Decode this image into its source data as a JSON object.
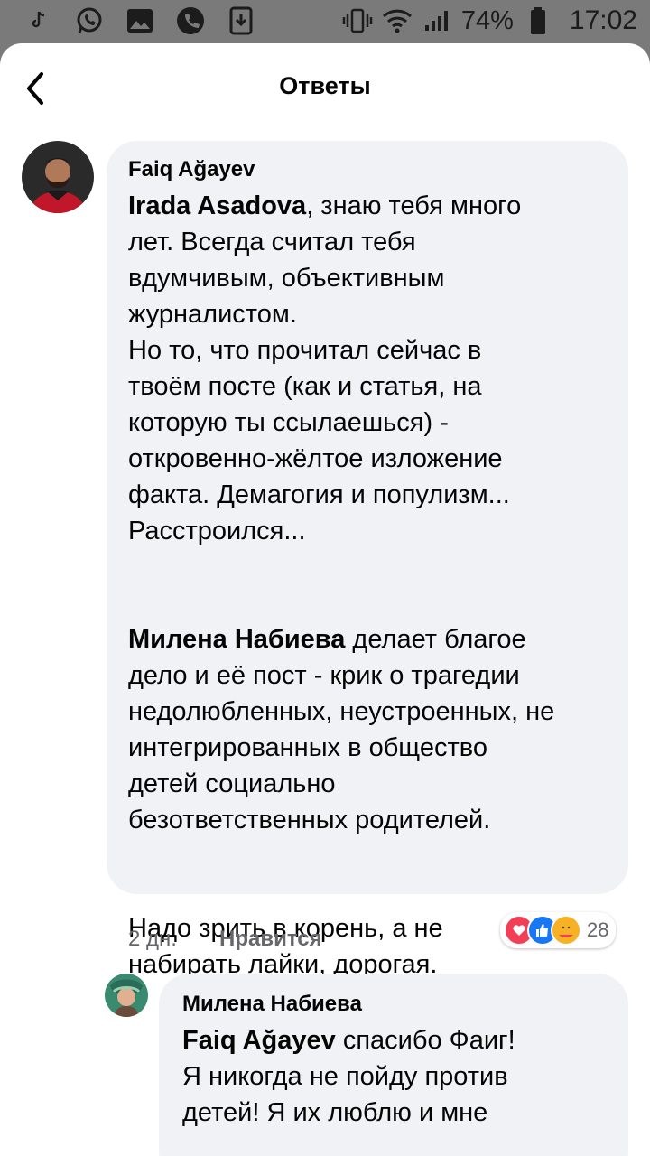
{
  "status_bar": {
    "battery_percent": "74%",
    "time": "17:02"
  },
  "header": {
    "title": "Ответы"
  },
  "comment": {
    "author": "Faiq Ağayev",
    "mention1": "Irada Asadova",
    "para1_rest": ", знаю тебя много\nлет. Всегда считал тебя\nвдумчивым, объективным\nжурналистом.\nНо то, что прочитал сейчас в\nтвоём посте (как и статья, на\nкоторую ты ссылаешься) -\nоткровенно-жёлтое изложение\nфакта. Демагогия и популизм...\nРасстроился...",
    "mention2": "Милена Набиева",
    "para2_rest": " делает благое\nдело и её пост - крик о трагедии\nнедолюбленных, неустроенных, не\nинтегрированных в общество\nдетей социально\nбезответственных родителей.",
    "para3": "Надо зрить в корень, а не\nнабирать лайки, дорогая.",
    "time": "2 дн.",
    "like_label": "Нравится",
    "reaction_count": "28"
  },
  "reply": {
    "author": "Милена Набиева",
    "mention": "Faiq Ağayev",
    "text_rest": " спасибо Фаиг!\nЯ никогда не пойду против\nдетей! Я их люблю и мне"
  }
}
